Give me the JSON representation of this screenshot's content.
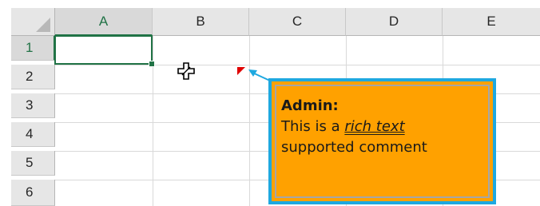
{
  "columns": [
    "A",
    "B",
    "C",
    "D",
    "E"
  ],
  "rows": [
    "1",
    "2",
    "3",
    "4",
    "5",
    "6"
  ],
  "active_column": "A",
  "active_row": "1",
  "colors": {
    "selection": "#217346",
    "comment_fill": "#ffa100",
    "comment_border": "#1ea8e0",
    "comment_indicator": "#e00000"
  },
  "comment": {
    "author": "Admin:",
    "text_before": "This is a ",
    "rich_text": "rich text",
    "text_after": "supported comment"
  },
  "icons": {
    "cursor": "cell-select-cursor-icon",
    "corner": "select-all-triangle-icon"
  }
}
